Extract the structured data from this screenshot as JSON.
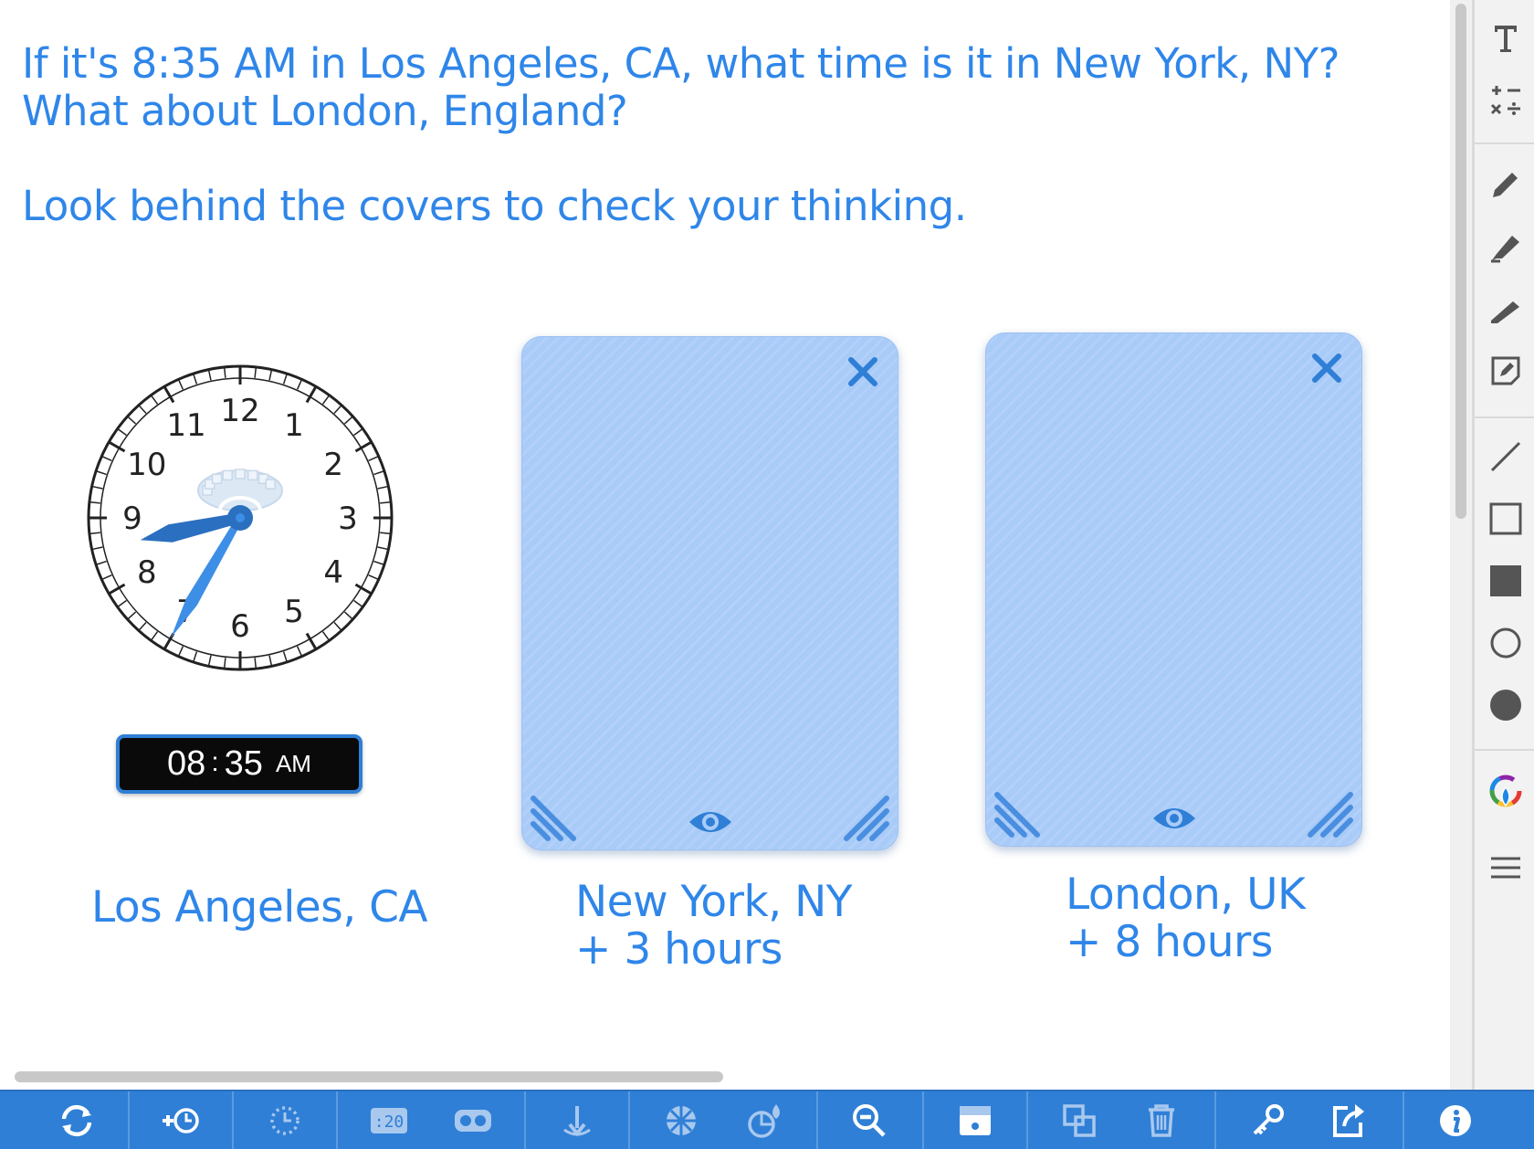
{
  "prompt": {
    "line1": "If it's 8:35 AM in Los Angeles, CA, what time is it in New York, NY?",
    "line2": "What about London, England?",
    "line3": "Look behind the covers to check your thinking."
  },
  "clock": {
    "numbers": [
      "12",
      "1",
      "2",
      "3",
      "4",
      "5",
      "6",
      "7",
      "8",
      "9",
      "10",
      "11"
    ],
    "hour": 8,
    "minute": 35,
    "digital": {
      "hours": "08",
      "colon": ":",
      "minutes": "35",
      "ampm": "AM"
    }
  },
  "cities": {
    "la": {
      "name": "Los Angeles, CA"
    },
    "ny": {
      "name": "New York, NY",
      "offset": "+ 3 hours"
    },
    "london": {
      "name": "London, UK",
      "offset": "+ 8 hours"
    }
  },
  "colors": {
    "accent": "#2f86e9",
    "toolbar_blue": "#2f7fd6",
    "cover_blue": "#a9cbf8",
    "cover_icon": "#2f7fd6",
    "hand_blue": "#2b6fc0",
    "minute_hand_blue": "#3d8ee6"
  },
  "right_toolbar": {
    "icons": [
      "text-icon",
      "math-symbols-icon",
      "pen-icon",
      "marker-icon",
      "highlighter-icon",
      "sticky-note-icon",
      "line-icon",
      "rectangle-outline-icon",
      "rectangle-filled-icon",
      "circle-outline-icon",
      "circle-filled-icon",
      "color-picker-icon",
      "menu-icon"
    ]
  },
  "bottom_toolbar": {
    "icons": [
      "reset-icon",
      "add-clock-icon",
      "clock-settings-icon",
      "digital-clock-icon",
      "tape-icon",
      "touch-icon",
      "spinner-icon",
      "shapes-icon",
      "zoom-out-icon",
      "cover-icon",
      "duplicate-icon",
      "trash-icon",
      "key-icon",
      "share-icon",
      "info-icon"
    ]
  }
}
